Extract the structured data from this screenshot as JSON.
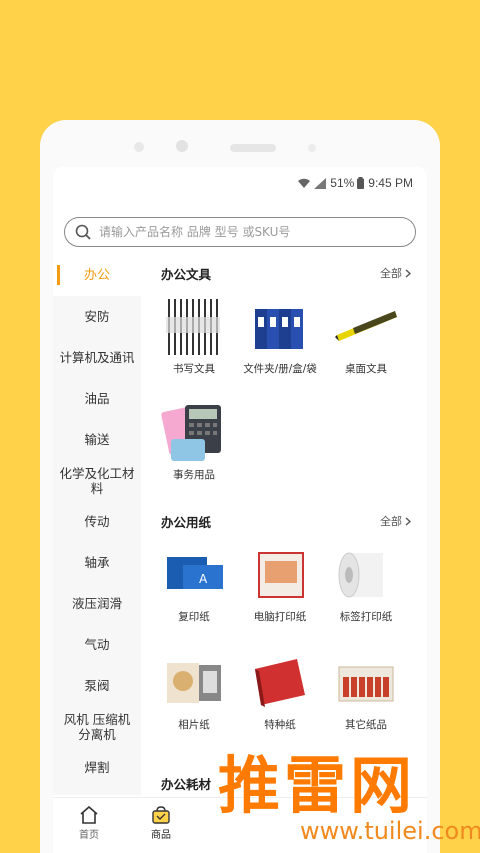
{
  "status": {
    "signal_text": "51%",
    "time": "9:45 PM"
  },
  "search": {
    "placeholder": "请输入产品名称 品牌 型号 或SKU号"
  },
  "sidebar": {
    "items": [
      {
        "label": "办公"
      },
      {
        "label": "安防"
      },
      {
        "label": "计算机及通讯"
      },
      {
        "label": "油品"
      },
      {
        "label": "输送"
      },
      {
        "label": "化学及化工材料"
      },
      {
        "label": "传动"
      },
      {
        "label": "轴承"
      },
      {
        "label": "液压润滑"
      },
      {
        "label": "气动"
      },
      {
        "label": "泵阀"
      },
      {
        "label": "风机 压缩机 分离机"
      },
      {
        "label": "焊割"
      }
    ]
  },
  "categories": [
    {
      "title": "办公文具",
      "more": "全部",
      "products": [
        {
          "label": "书写文具"
        },
        {
          "label": "文件夹/册/盒/袋"
        },
        {
          "label": "桌面文具"
        },
        {
          "label": "事务用品"
        }
      ]
    },
    {
      "title": "办公用纸",
      "more": "全部",
      "products": [
        {
          "label": "复印纸"
        },
        {
          "label": "电脑打印纸"
        },
        {
          "label": "标签打印纸"
        },
        {
          "label": "相片纸"
        },
        {
          "label": "特种纸"
        },
        {
          "label": "其它纸品"
        }
      ]
    },
    {
      "title": "办公耗材"
    }
  ],
  "tabbar": {
    "items": [
      {
        "label": "首页"
      },
      {
        "label": "商品"
      }
    ]
  },
  "watermark": {
    "text": "推雷网",
    "url": "www.tuilei.com"
  },
  "colors": {
    "accent": "#F39C12",
    "background": "#FFD24A",
    "watermark": "#FF7A00"
  }
}
